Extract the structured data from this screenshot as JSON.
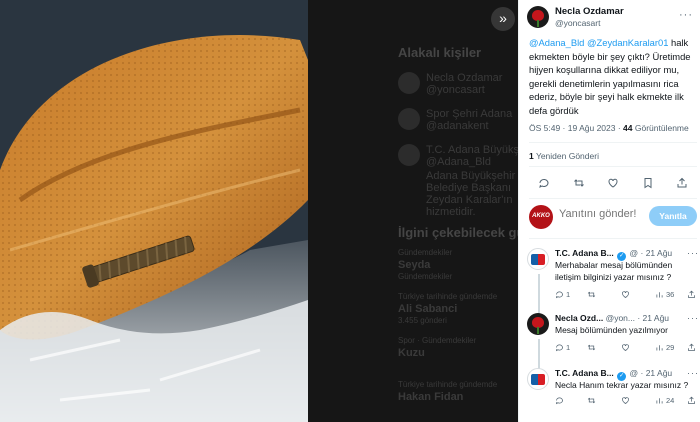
{
  "viewer": {
    "expand_icon": "»",
    "background_ghost": {
      "heading_1": "Alakalı kişiler",
      "people": [
        {
          "name": "Necla Ozdamar",
          "handle": "@yoncasart"
        },
        {
          "name": "Spor Şehri Adana",
          "handle": "@adanakent"
        },
        {
          "name": "T.C. Adana Büyükşehir Belediyesi",
          "handle": "@Adana_Bld"
        }
      ],
      "bio": "Adana Büyükşehir Belediye Başkanı Zeydan Karalar'ın hizmetidir.",
      "heading_2": "İlgini çekebilecek gündem",
      "trends": [
        {
          "label": "Gündemdekiler",
          "name": "Seyda",
          "count": "Gündemdekiler"
        },
        {
          "label": "Türkiye tarihinde gündemde",
          "name": "Ali Sabanci",
          "count": "3.455 gönderi"
        },
        {
          "label": "Spor · Gündemdekiler",
          "name": "Kuzu",
          "count": ""
        },
        {
          "label": "Türkiye tarihinde gündemde",
          "name": "Hakan Fidan",
          "count": ""
        }
      ]
    }
  },
  "tweet": {
    "author_name": "Necla Ozdamar",
    "author_handle": "@yoncasart",
    "more_icon": "more-icon",
    "mention_1": "@Adana_Bld",
    "mention_2": "@ZeydanKaralar01",
    "text": " halk ekmekten böyle bir şey çıktı? Üretimde hijyen koşullarına dikkat ediliyor mu, gerekli denetimlerin yapılmasını rica ederiz, böyle bir şeyi halk ekmekte ilk defa gördük",
    "time": "ÖS 5:49 · 19 Ağu 2023 · ",
    "views_count": "44",
    "views_label": " Görüntülenme",
    "retweet_count": "1",
    "retweet_label": " Yeniden Gönderi"
  },
  "reply_composer": {
    "avatar_text": "AKKO",
    "placeholder": "Yanıtını gönder!",
    "button_label": "Yanıtla"
  },
  "replies": [
    {
      "name": "T.C. Adana B...",
      "verified": true,
      "handle": "@",
      "time": "· 21 Ağu",
      "text": "Merhabalar mesaj bölümünden iletişim bilginizi yazar mısınız ?",
      "replies": "1",
      "retweets": "",
      "likes": "",
      "views": "36"
    },
    {
      "name": "Necla Ozd...",
      "verified": false,
      "handle": "@yon...",
      "time": "· 21 Ağu",
      "text": "Mesaj bölümünden yazılmıyor",
      "replies": "1",
      "retweets": "",
      "likes": "",
      "views": "29"
    },
    {
      "name": "T.C. Adana B...",
      "verified": true,
      "handle": "@",
      "time": "· 21 Ağu",
      "text": "Necla Hanım tekrar  yazar mısınız ?",
      "replies": "",
      "retweets": "",
      "likes": "",
      "views": "24"
    }
  ],
  "colors": {
    "accent": "#1d9bf0",
    "reply_button": "#8ecdf8",
    "text_primary": "#0f1419",
    "text_secondary": "#536471"
  }
}
